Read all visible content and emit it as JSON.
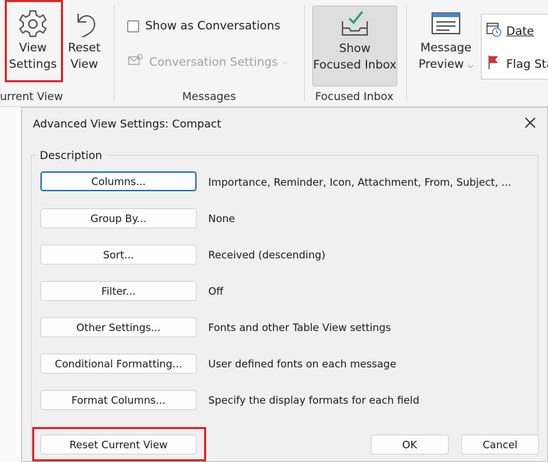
{
  "ribbon": {
    "view_settings": {
      "line1": "View",
      "line2": "Settings"
    },
    "reset_view": {
      "line1": "Reset",
      "line2": "View"
    },
    "current_view_group": "urrent View",
    "show_as_conversations": "Show as Conversations",
    "conversation_settings": "Conversation Settings",
    "messages_group": "Messages",
    "show_focused_inbox": {
      "line1": "Show",
      "line2": "Focused Inbox"
    },
    "focused_inbox_group": "Focused Inbox",
    "message_preview": {
      "line1": "Message",
      "line2": "Preview"
    },
    "arrange_date": "Date",
    "arrange_flag": "Flag Sta"
  },
  "dialog": {
    "title": "Advanced View Settings: Compact",
    "section_label": "Description",
    "rows": [
      {
        "button": "Columns...",
        "description": "Importance, Reminder, Icon, Attachment, From, Subject, ..."
      },
      {
        "button": "Group By...",
        "description": "None"
      },
      {
        "button": "Sort...",
        "description": "Received (descending)"
      },
      {
        "button": "Filter...",
        "description": "Off"
      },
      {
        "button": "Other Settings...",
        "description": "Fonts and other Table View settings"
      },
      {
        "button": "Conditional Formatting...",
        "description": "User defined fonts on each message"
      },
      {
        "button": "Format Columns...",
        "description": "Specify the display formats for each field"
      }
    ],
    "reset_current_view": "Reset Current View",
    "ok": "OK",
    "cancel": "Cancel"
  },
  "colors": {
    "highlight": "#e02424",
    "accent": "#1a6fc4",
    "focused_check": "#2e9e6a",
    "flag": "#d13438"
  }
}
